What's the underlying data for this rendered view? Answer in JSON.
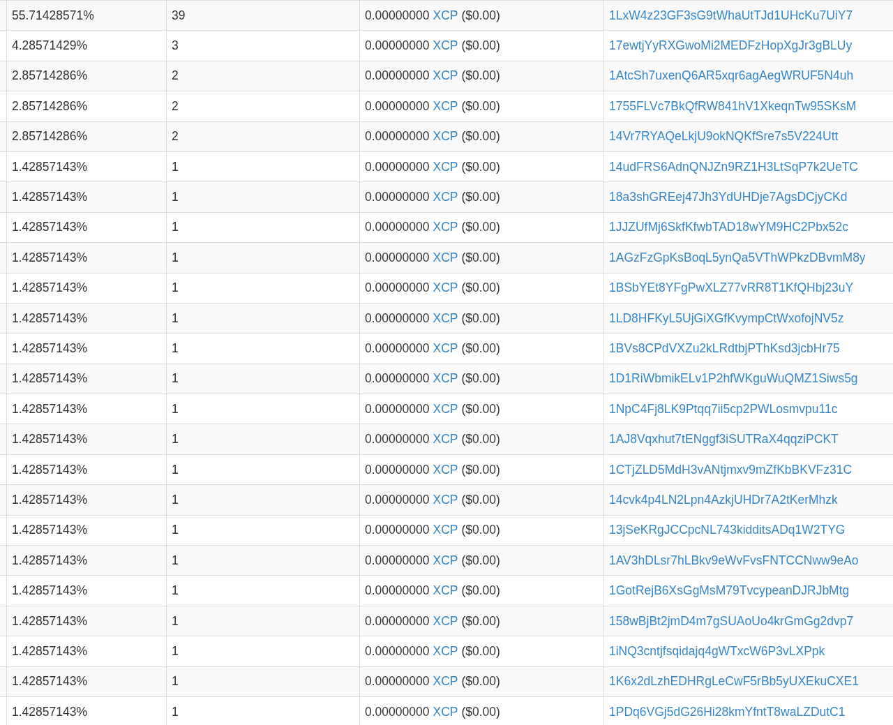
{
  "table": {
    "rows": [
      {
        "percent": "55.71428571%",
        "count": "39",
        "amount": "0.00000000",
        "asset": "XCP",
        "usd": "($0.00)",
        "address": "1LxW4z23GF3sG9tWhaUtTJd1UHcKu7UiY7"
      },
      {
        "percent": "4.28571429%",
        "count": "3",
        "amount": "0.00000000",
        "asset": "XCP",
        "usd": "($0.00)",
        "address": "17ewtjYyRXGwoMi2MEDFzHopXgJr3gBLUy"
      },
      {
        "percent": "2.85714286%",
        "count": "2",
        "amount": "0.00000000",
        "asset": "XCP",
        "usd": "($0.00)",
        "address": "1AtcSh7uxenQ6AR5xqr6agAegWRUF5N4uh"
      },
      {
        "percent": "2.85714286%",
        "count": "2",
        "amount": "0.00000000",
        "asset": "XCP",
        "usd": "($0.00)",
        "address": "1755FLVc7BkQfRW841hV1XkeqnTw95SKsM"
      },
      {
        "percent": "2.85714286%",
        "count": "2",
        "amount": "0.00000000",
        "asset": "XCP",
        "usd": "($0.00)",
        "address": "14Vr7RYAQeLkjU9okNQKfSre7s5V224Utt"
      },
      {
        "percent": "1.42857143%",
        "count": "1",
        "amount": "0.00000000",
        "asset": "XCP",
        "usd": "($0.00)",
        "address": "14udFRS6AdnQNJZn9RZ1H3LtSqP7k2UeTC"
      },
      {
        "percent": "1.42857143%",
        "count": "1",
        "amount": "0.00000000",
        "asset": "XCP",
        "usd": "($0.00)",
        "address": "18a3shGREej47Jh3YdUHDje7AgsDCjyCKd"
      },
      {
        "percent": "1.42857143%",
        "count": "1",
        "amount": "0.00000000",
        "asset": "XCP",
        "usd": "($0.00)",
        "address": "1JJZUfMj6SkfKfwbTAD18wYM9HC2Pbx52c"
      },
      {
        "percent": "1.42857143%",
        "count": "1",
        "amount": "0.00000000",
        "asset": "XCP",
        "usd": "($0.00)",
        "address": "1AGzFzGpKsBoqL5ynQa5VThWPkzDBvmM8y"
      },
      {
        "percent": "1.42857143%",
        "count": "1",
        "amount": "0.00000000",
        "asset": "XCP",
        "usd": "($0.00)",
        "address": "1BSbYEt8YFgPwXLZ77vRR8T1KfQHbj23uY"
      },
      {
        "percent": "1.42857143%",
        "count": "1",
        "amount": "0.00000000",
        "asset": "XCP",
        "usd": "($0.00)",
        "address": "1LD8HFKyL5UjGiXGfKvympCtWxofojNV5z"
      },
      {
        "percent": "1.42857143%",
        "count": "1",
        "amount": "0.00000000",
        "asset": "XCP",
        "usd": "($0.00)",
        "address": "1BVs8CPdVXZu2kLRdtbjPThKsd3jcbHr75"
      },
      {
        "percent": "1.42857143%",
        "count": "1",
        "amount": "0.00000000",
        "asset": "XCP",
        "usd": "($0.00)",
        "address": "1D1RiWbmikELv1P2hfWKguWuQMZ1Siws5g"
      },
      {
        "percent": "1.42857143%",
        "count": "1",
        "amount": "0.00000000",
        "asset": "XCP",
        "usd": "($0.00)",
        "address": "1NpC4Fj8LK9Ptqq7ii5cp2PWLosmvpu11c"
      },
      {
        "percent": "1.42857143%",
        "count": "1",
        "amount": "0.00000000",
        "asset": "XCP",
        "usd": "($0.00)",
        "address": "1AJ8Vqxhut7tENggf3iSUTRaX4qqziPCKT"
      },
      {
        "percent": "1.42857143%",
        "count": "1",
        "amount": "0.00000000",
        "asset": "XCP",
        "usd": "($0.00)",
        "address": "1CTjZLD5MdH3vANtjmxv9mZfKbBKVFz31C"
      },
      {
        "percent": "1.42857143%",
        "count": "1",
        "amount": "0.00000000",
        "asset": "XCP",
        "usd": "($0.00)",
        "address": "14cvk4p4LN2Lpn4AzkjUHDr7A2tKerMhzk"
      },
      {
        "percent": "1.42857143%",
        "count": "1",
        "amount": "0.00000000",
        "asset": "XCP",
        "usd": "($0.00)",
        "address": "13jSeKRgJCCpcNL743kidditsADq1W2TYG"
      },
      {
        "percent": "1.42857143%",
        "count": "1",
        "amount": "0.00000000",
        "asset": "XCP",
        "usd": "($0.00)",
        "address": "1AV3hDLsr7hLBkv9eWvFvsFNTCCNww9eAo"
      },
      {
        "percent": "1.42857143%",
        "count": "1",
        "amount": "0.00000000",
        "asset": "XCP",
        "usd": "($0.00)",
        "address": "1GotRejB6XsGgMsM79TvcypeanDJRJbMtg"
      },
      {
        "percent": "1.42857143%",
        "count": "1",
        "amount": "0.00000000",
        "asset": "XCP",
        "usd": "($0.00)",
        "address": "158wBjBt2jmD4m7gSUAoUo4krGmGg2dvp7"
      },
      {
        "percent": "1.42857143%",
        "count": "1",
        "amount": "0.00000000",
        "asset": "XCP",
        "usd": "($0.00)",
        "address": "1iNQ3cntjfsqidajq4gWTxcW6P3vLXPpk"
      },
      {
        "percent": "1.42857143%",
        "count": "1",
        "amount": "0.00000000",
        "asset": "XCP",
        "usd": "($0.00)",
        "address": "1K6x2dLzhEDHRgLeCwF5rBb5yUXEkuCXE1"
      },
      {
        "percent": "1.42857143%",
        "count": "1",
        "amount": "0.00000000",
        "asset": "XCP",
        "usd": "($0.00)",
        "address": "1PDq6VGj5dG26Hi28kmYfntT8waLZDutC1"
      }
    ]
  }
}
